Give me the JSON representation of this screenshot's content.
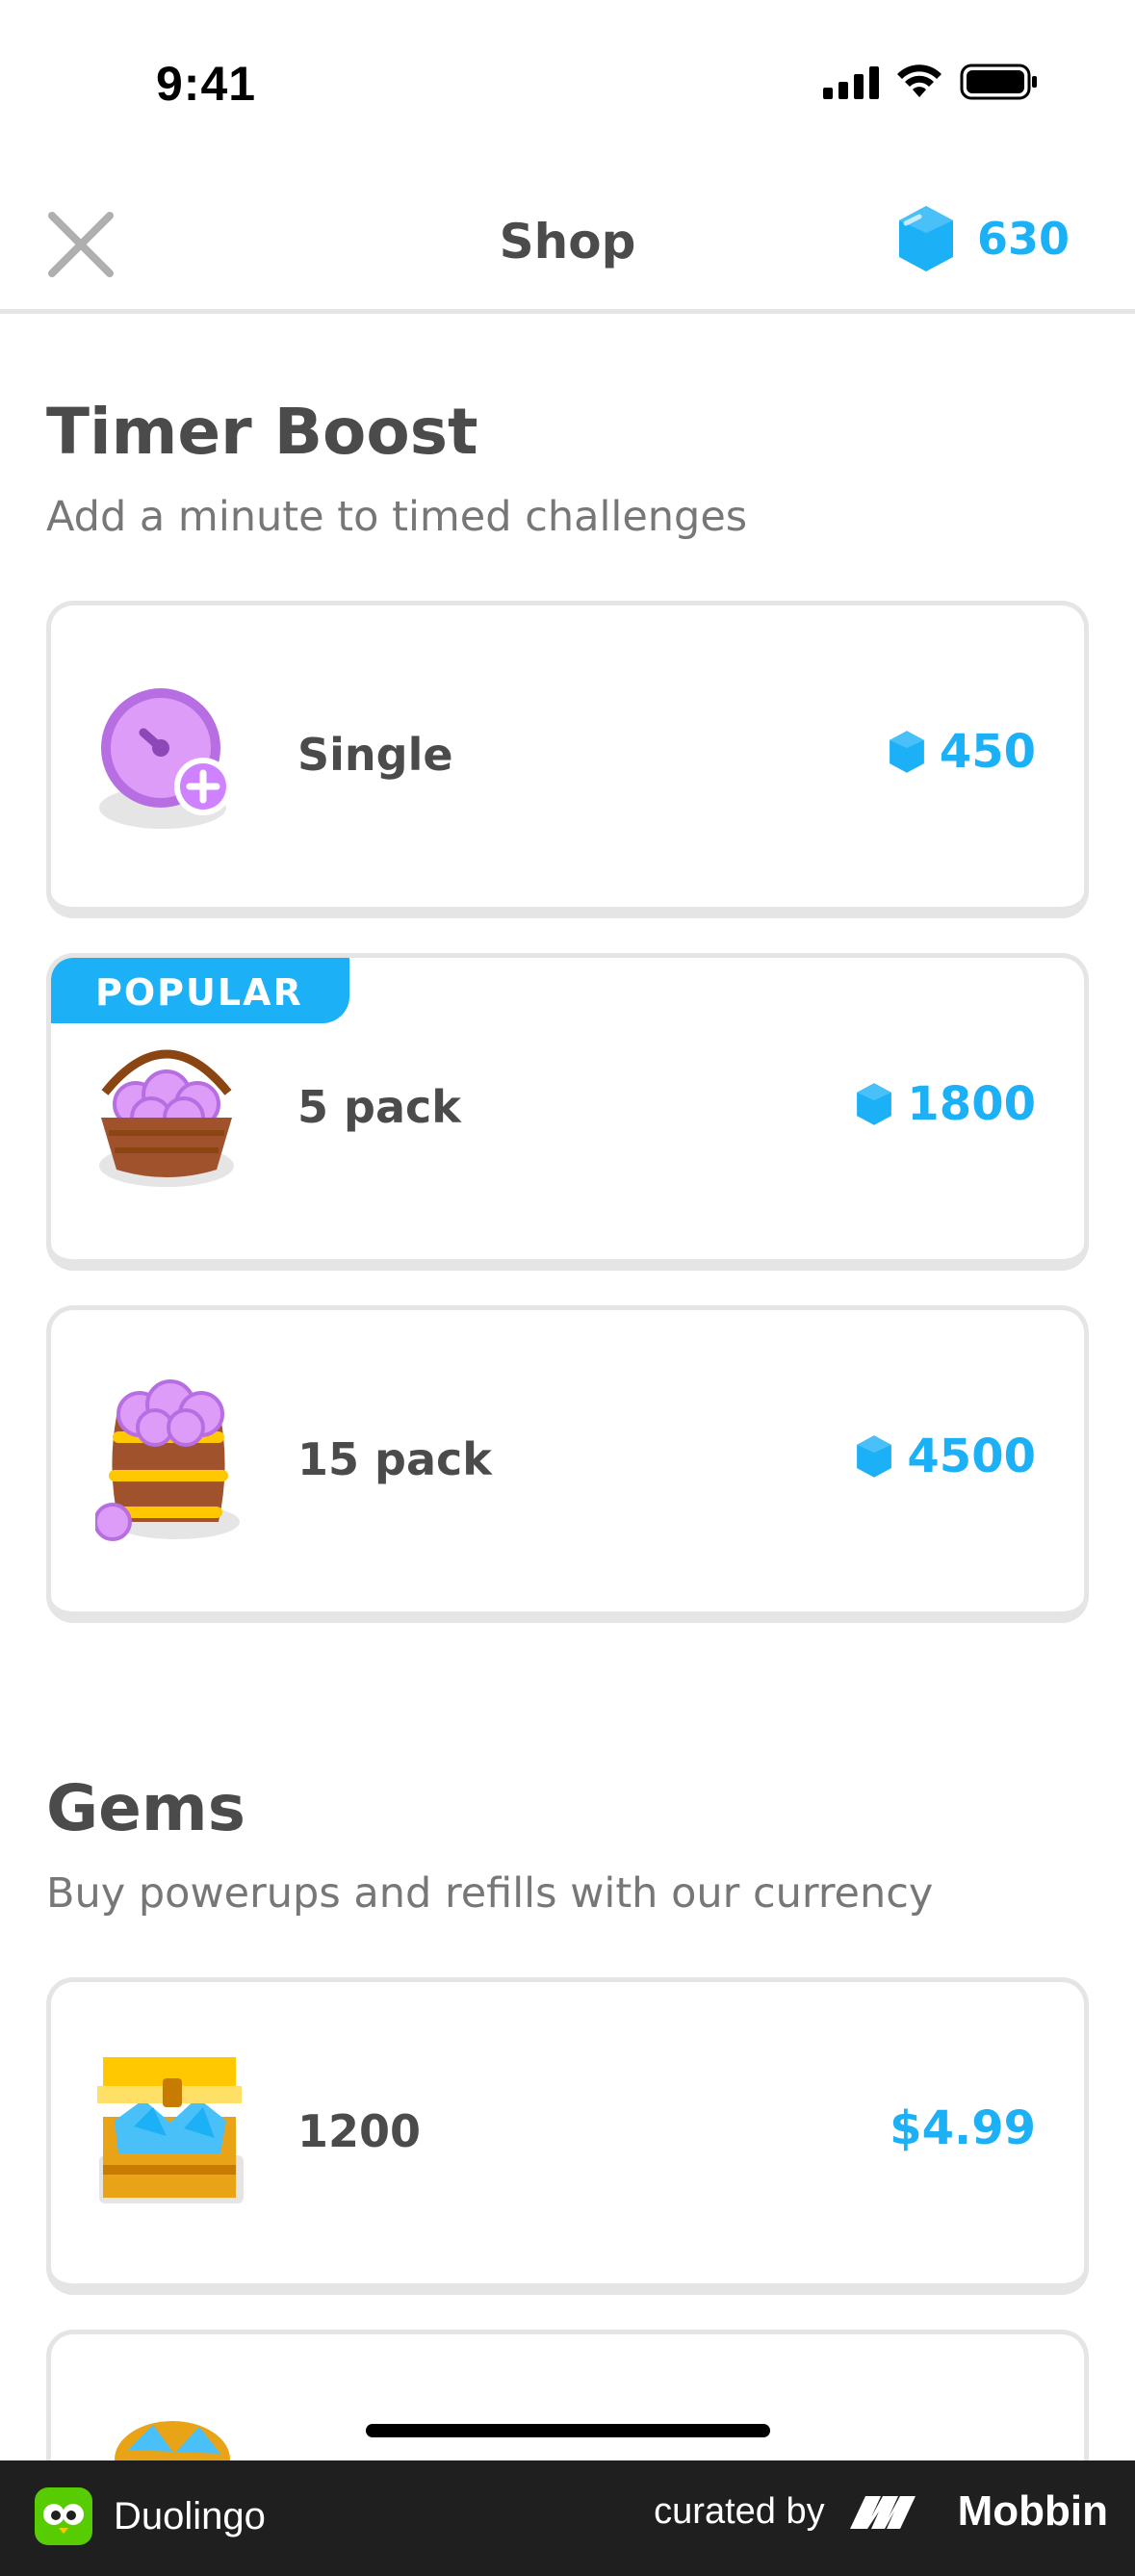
{
  "status_bar": {
    "time": "9:41"
  },
  "header": {
    "title": "Shop",
    "gem_balance": "630"
  },
  "timer_boost": {
    "title": "Timer Boost",
    "subtitle": "Add a minute to timed challenges",
    "items": [
      {
        "label": "Single",
        "price": "450",
        "icon": "timer-single-icon"
      },
      {
        "label": "5 pack",
        "price": "1800",
        "badge": "POPULAR",
        "icon": "timer-basket-icon"
      },
      {
        "label": "15 pack",
        "price": "4500",
        "icon": "timer-barrel-icon"
      }
    ]
  },
  "gems": {
    "title": "Gems",
    "subtitle": "Buy powerups and refills with our currency",
    "items": [
      {
        "label": "1200",
        "price": "$4.99",
        "icon": "gem-chest-icon"
      }
    ]
  },
  "footer": {
    "app_name": "Duolingo",
    "curated_by": "curated by",
    "brand": "Mobbin"
  },
  "colors": {
    "accent": "#1cb0f6",
    "text": "#4b4b4b",
    "subtext": "#777777",
    "border": "#e5e5e5"
  }
}
